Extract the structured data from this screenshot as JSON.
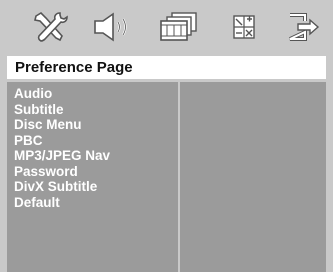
{
  "icons": [
    {
      "name": "setup-tools-icon"
    },
    {
      "name": "audio-speaker-icon"
    },
    {
      "name": "video-film-icon"
    },
    {
      "name": "preferences-icon"
    },
    {
      "name": "exit-icon"
    }
  ],
  "title": "Preference Page",
  "menu": {
    "items": [
      {
        "label": "Audio"
      },
      {
        "label": "Subtitle"
      },
      {
        "label": "Disc Menu"
      },
      {
        "label": "PBC"
      },
      {
        "label": "MP3/JPEG Nav"
      },
      {
        "label": "Password"
      },
      {
        "label": "DivX Subtitle"
      },
      {
        "label": "Default"
      }
    ]
  },
  "colors": {
    "background": "#c9c9c9",
    "panel": "#9b9b9b",
    "title_bar": "#ffffff",
    "menu_text": "#ffffff",
    "icon_fill": "#ffffff",
    "icon_stroke": "#555555"
  }
}
